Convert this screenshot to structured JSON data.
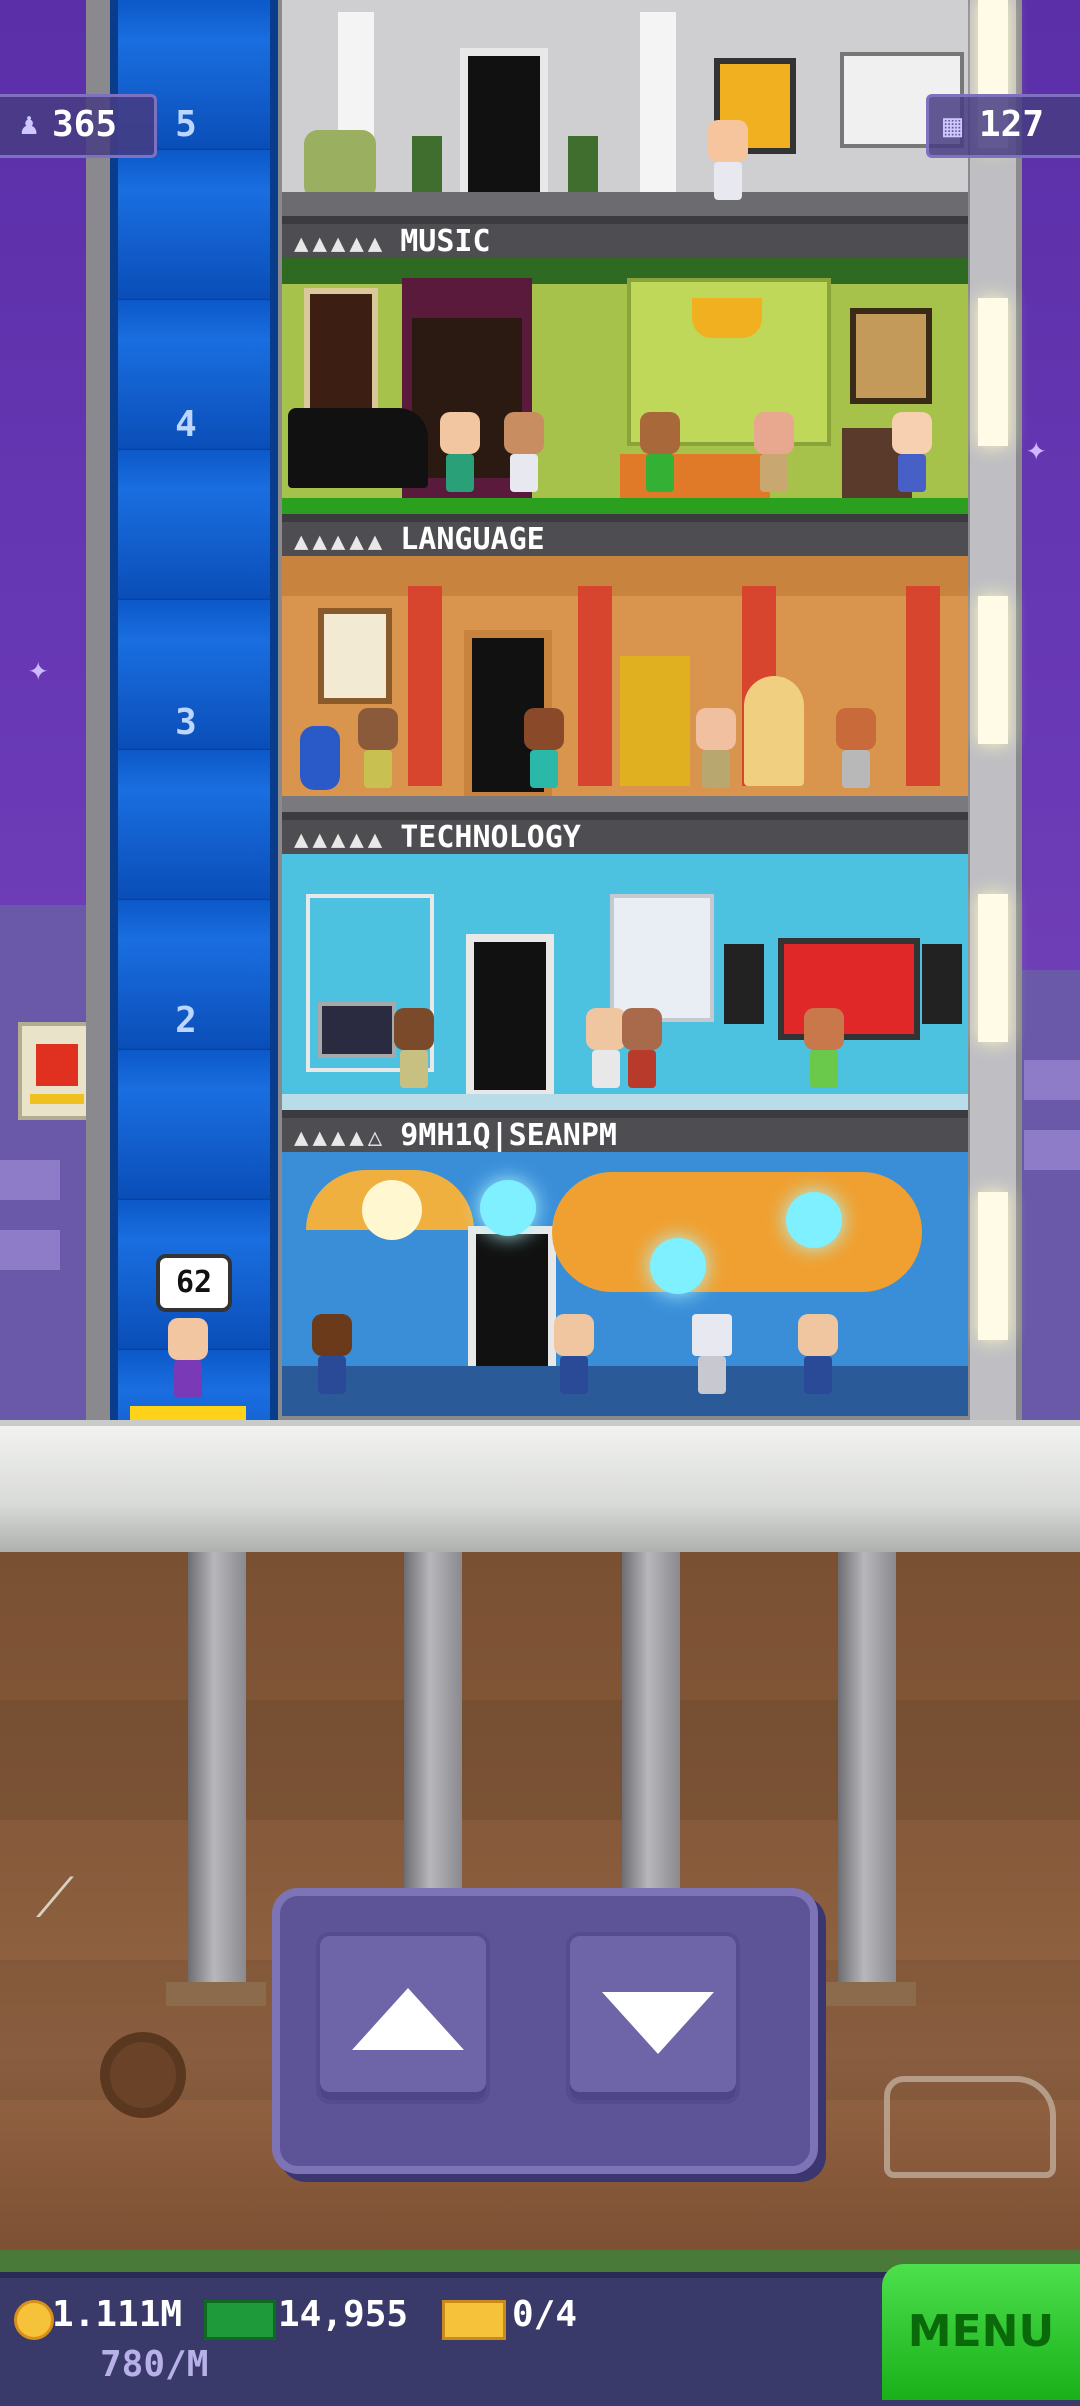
{
  "hud": {
    "population": "365",
    "floors_count": "127"
  },
  "elevator": {
    "shaft_numbers": [
      "5",
      "4",
      "3",
      "2"
    ],
    "passenger_badge": "62"
  },
  "floors": [
    {
      "name": "MUSIC",
      "stars": "▲▲▲▲▲",
      "wall": "#a6c24a",
      "accent": "#6a1e4a"
    },
    {
      "name": "LANGUAGE",
      "stars": "▲▲▲▲▲",
      "wall": "#d9954e",
      "accent": "#d8452e"
    },
    {
      "name": "TECHNOLOGY",
      "stars": "▲▲▲▲▲",
      "wall": "#4cc2e0",
      "accent": "#e8e8e8"
    },
    {
      "name": "9MH1Q|SEANPM",
      "stars": "▲▲▲▲△",
      "wall": "#3a8ed8",
      "accent": "#f0a030"
    }
  ],
  "footer": {
    "coins": "1.111M",
    "coin_rate": "780/M",
    "bux": "14,955",
    "tickets": "0/4",
    "menu_label": "MENU"
  },
  "icons": {
    "population": "person-icon",
    "floors": "building-icon",
    "coin": "coin-icon",
    "bux": "cash-icon",
    "ticket": "ticket-icon",
    "up": "arrow-up-icon",
    "down": "arrow-down-icon"
  },
  "colors": {
    "sky": "#5a2fa8",
    "shaft": "#0c58c8",
    "menu": "#2bc42b",
    "panel": "#5c5496"
  }
}
